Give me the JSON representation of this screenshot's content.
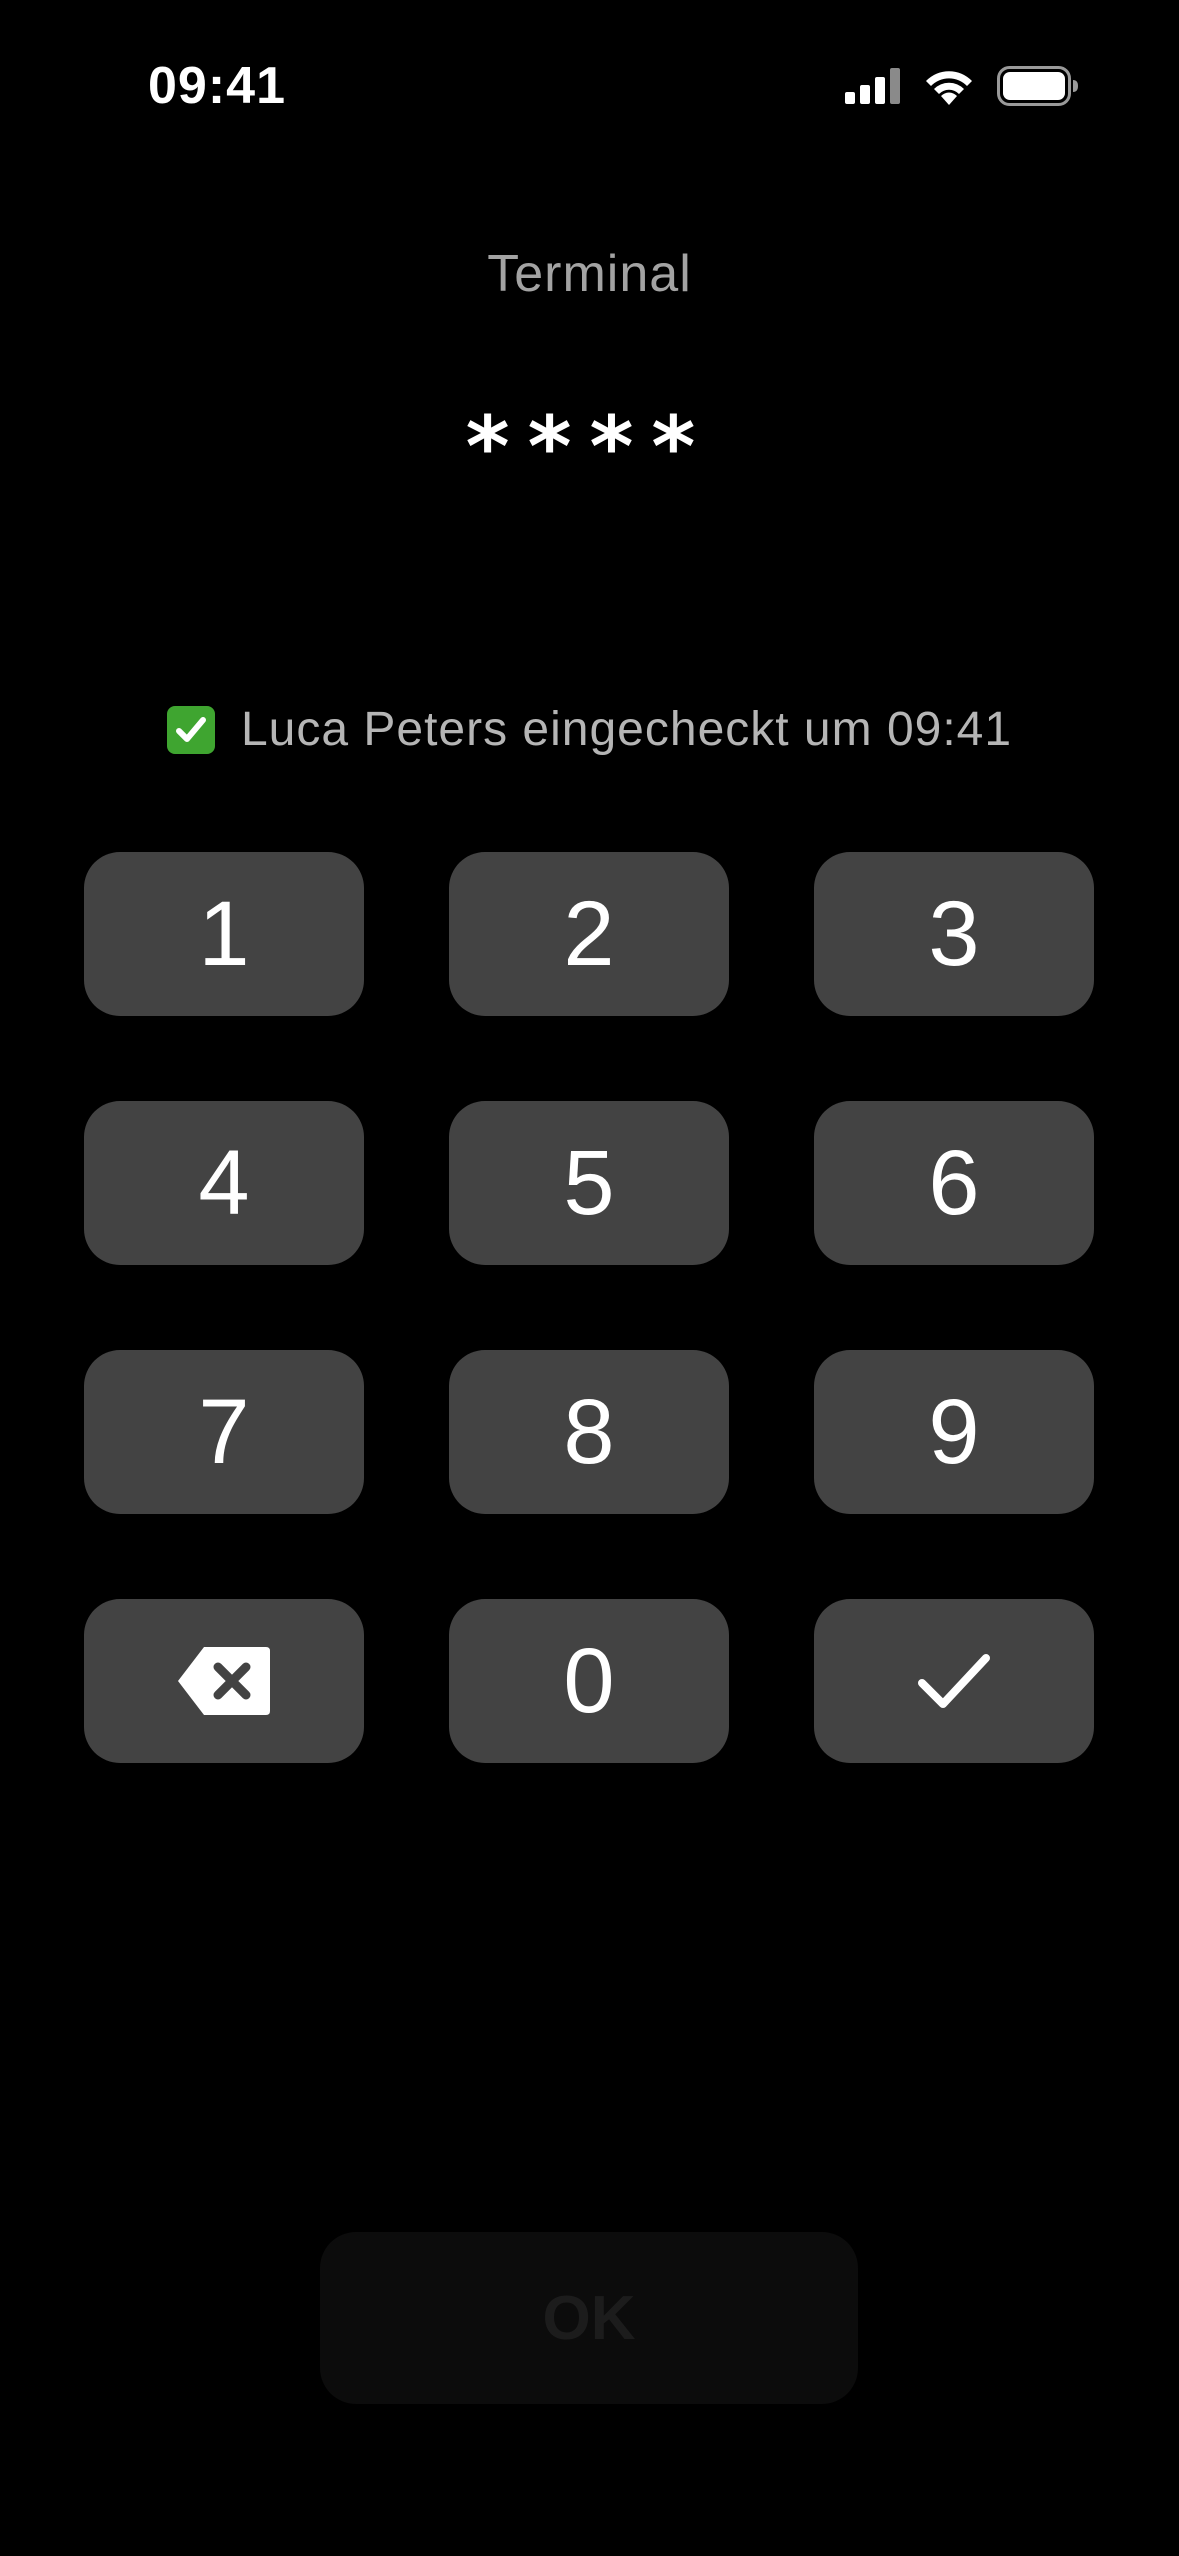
{
  "status_bar": {
    "time": "09:41",
    "icons": [
      "cellular-signal-icon",
      "wifi-icon",
      "battery-icon"
    ]
  },
  "title": "Terminal",
  "pin_display": "****",
  "checkin": {
    "icon": "check-mark-emoji-icon",
    "message": "Luca Peters eingecheckt um 09:41"
  },
  "keypad": {
    "keys": [
      "1",
      "2",
      "3",
      "4",
      "5",
      "6",
      "7",
      "8",
      "9"
    ],
    "zero": "0",
    "backspace_icon": "backspace-icon",
    "confirm_icon": "checkmark-icon"
  },
  "ok_button": {
    "label": "OK",
    "state": "disabled"
  },
  "colors": {
    "background": "#000000",
    "key_background": "#434343",
    "title_text": "#a3a3a3",
    "checkin_text": "#b5b5b5",
    "check_emoji": "#3fa530",
    "ok_disabled_background": "#0c0c0c"
  }
}
